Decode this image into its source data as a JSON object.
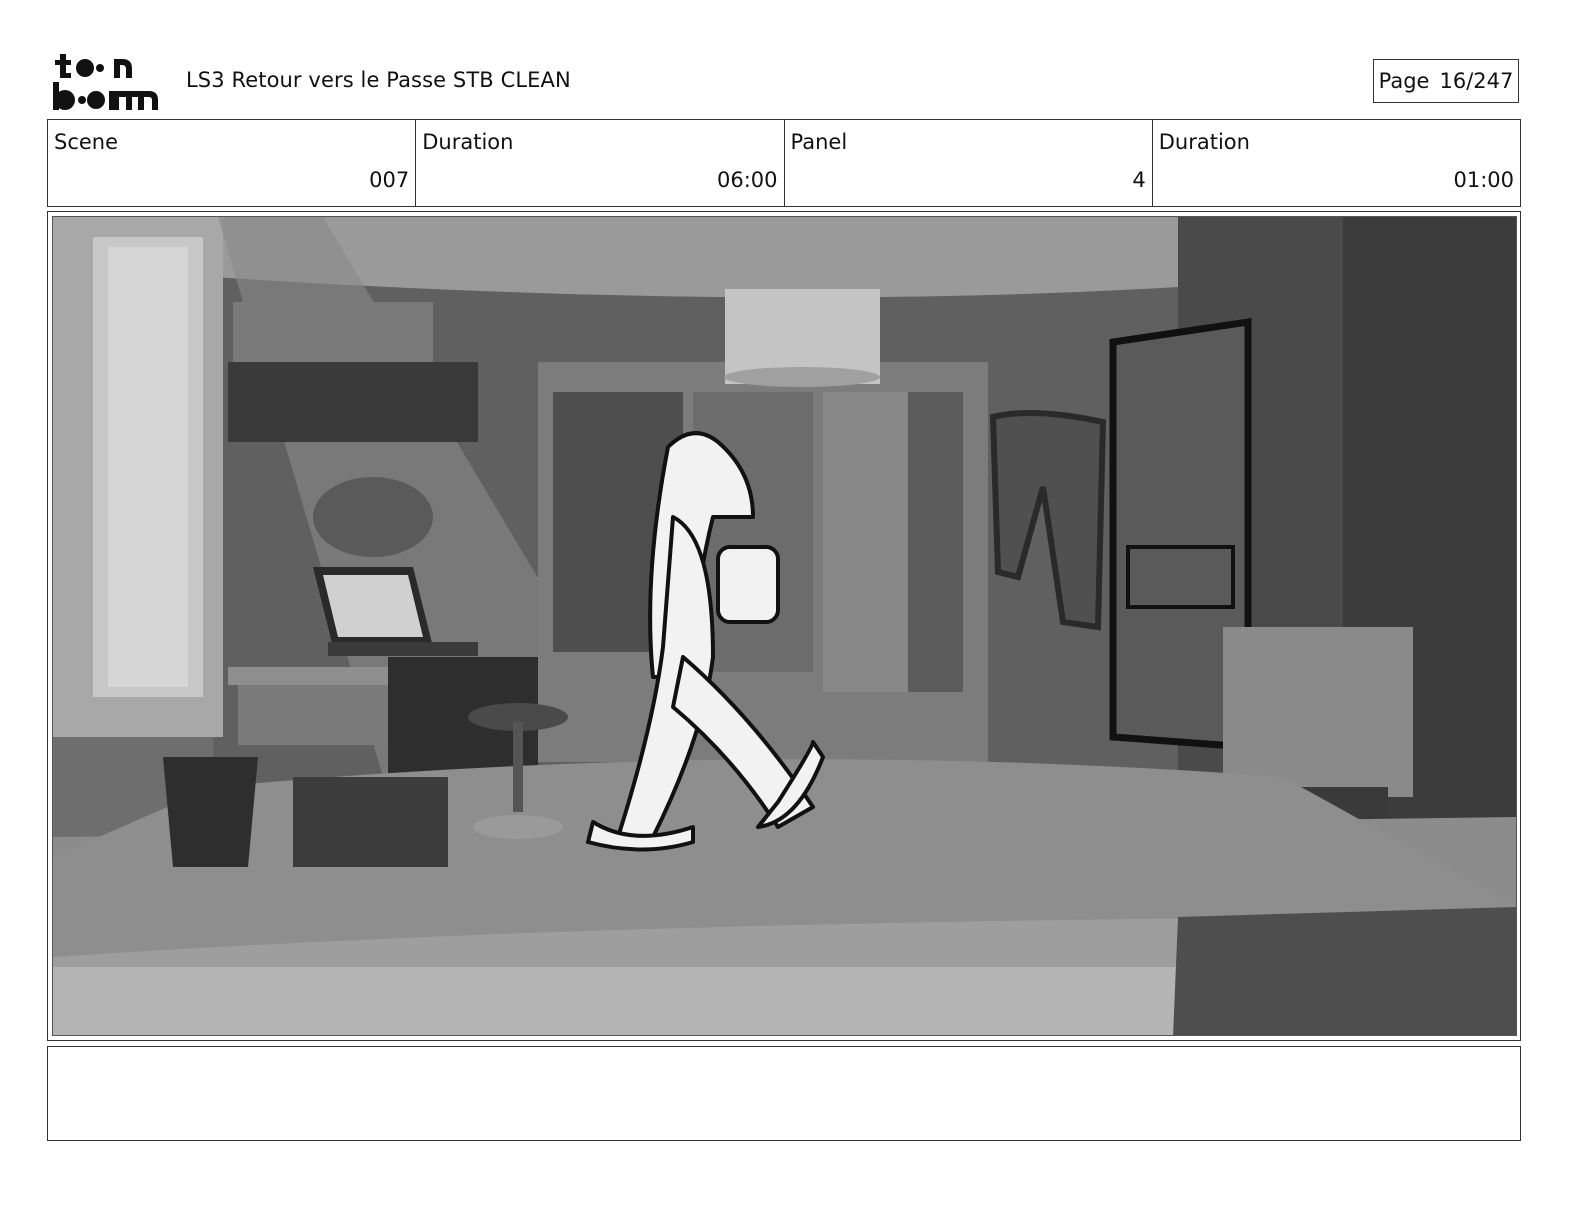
{
  "header": {
    "logo_text": "toonboom",
    "project_title": "LS3 Retour vers le Passe STB CLEAN",
    "page_label": "Page",
    "page_number": "16/247"
  },
  "info": [
    {
      "label": "Scene",
      "value": "007"
    },
    {
      "label": "Duration",
      "value": "06:00"
    },
    {
      "label": "Panel",
      "value": "4"
    },
    {
      "label": "Duration",
      "value": "01:00"
    }
  ],
  "caption": {
    "text": ""
  }
}
